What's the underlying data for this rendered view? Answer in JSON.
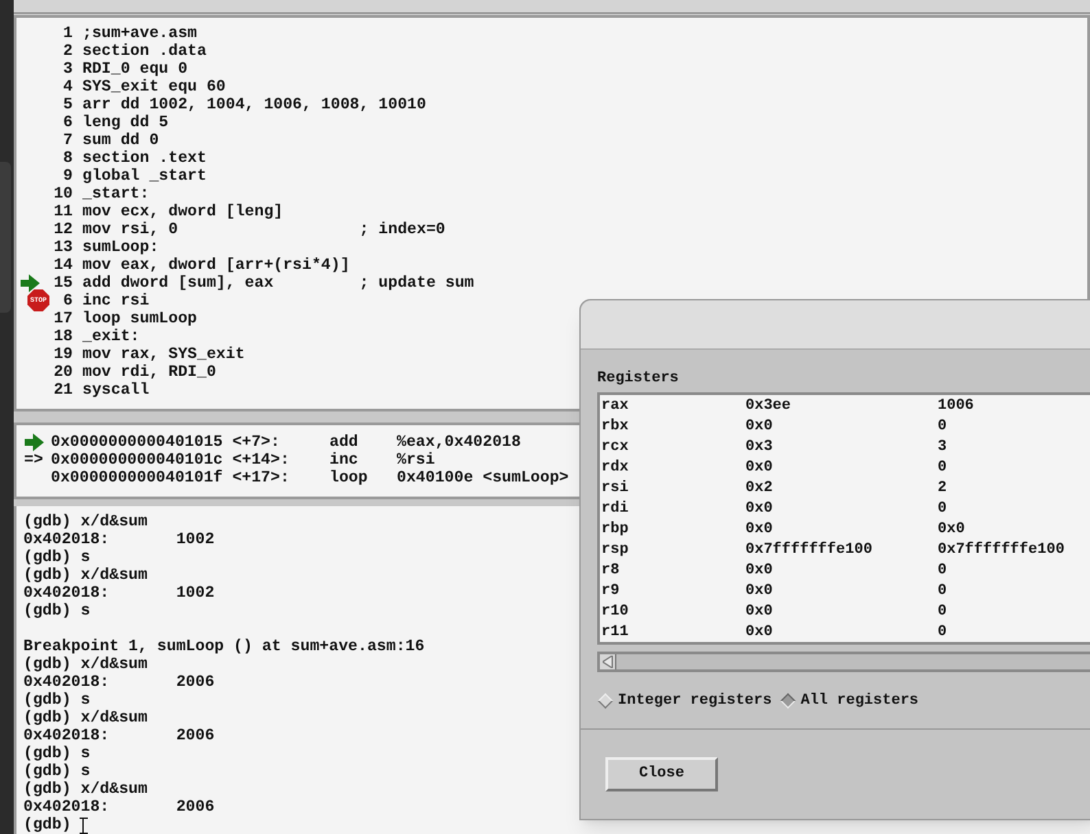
{
  "source": {
    "lines": [
      {
        "number": "1",
        "code": ";sum+ave.asm"
      },
      {
        "number": "2",
        "code": "section .data"
      },
      {
        "number": "3",
        "code": "RDI_0 equ 0"
      },
      {
        "number": "4",
        "code": "SYS_exit equ 60"
      },
      {
        "number": "5",
        "code": "arr dd 1002, 1004, 1006, 1008, 10010"
      },
      {
        "number": "6",
        "code": "leng dd 5"
      },
      {
        "number": "7",
        "code": "sum dd 0"
      },
      {
        "number": "8",
        "code": "section .text"
      },
      {
        "number": "9",
        "code": "global _start"
      },
      {
        "number": "10",
        "code": "_start:"
      },
      {
        "number": "11",
        "code": "mov ecx, dword [leng]"
      },
      {
        "number": "12",
        "code": "mov rsi, 0                   ; index=0"
      },
      {
        "number": "13",
        "code": "sumLoop:"
      },
      {
        "number": "14",
        "code": "mov eax, dword [arr+(rsi*4)]"
      },
      {
        "number": "15",
        "code": "add dword [sum], eax         ; update sum",
        "kind": "execution_line"
      },
      {
        "number": "6",
        "code": "inc rsi",
        "kind": "breakpoint_line",
        "stop_label": "STOP"
      },
      {
        "number": "17",
        "code": "loop sumLoop"
      },
      {
        "number": "18",
        "code": "_exit:"
      },
      {
        "number": "19",
        "code": "mov rax, SYS_exit"
      },
      {
        "number": "20",
        "code": "mov rdi, RDI_0"
      },
      {
        "number": "21",
        "code": "syscall"
      }
    ]
  },
  "disassembly": {
    "lines": [
      {
        "kind": "execution_line",
        "address": "0x0000000000401015 <+7>:",
        "mnemonic": "add",
        "operands": "%eax,0x402018"
      },
      {
        "kind": "current_line",
        "marker_text": "=>",
        "address": "0x000000000040101c <+14>:",
        "mnemonic": "inc",
        "operands": "%rsi"
      },
      {
        "address": "0x000000000040101f <+17>:",
        "mnemonic": "loop",
        "operands": "0x40100e <sumLoop>"
      }
    ]
  },
  "console": {
    "lines": [
      {
        "text": "(gdb) x/d&sum"
      },
      {
        "text": "0x402018:       1002"
      },
      {
        "text": "(gdb) s"
      },
      {
        "text": "(gdb) x/d&sum"
      },
      {
        "text": "0x402018:       1002"
      },
      {
        "text": "(gdb) s"
      },
      {
        "kind": "blank"
      },
      {
        "text": "Breakpoint 1, sumLoop () at sum+ave.asm:16"
      },
      {
        "text": "(gdb) x/d&sum"
      },
      {
        "text": "0x402018:       2006"
      },
      {
        "text": "(gdb) s"
      },
      {
        "text": "(gdb) x/d&sum"
      },
      {
        "text": "0x402018:       2006"
      },
      {
        "text": "(gdb) s"
      },
      {
        "text": "(gdb) s"
      },
      {
        "text": "(gdb) x/d&sum"
      },
      {
        "text": "0x402018:       2006"
      },
      {
        "text": "(gdb) ",
        "kind": "prompt"
      }
    ]
  },
  "registers_dialog": {
    "title": "Registers",
    "rows": [
      {
        "name": "rax",
        "raw": "0x3ee",
        "natural": "1006"
      },
      {
        "name": "rbx",
        "raw": "0x0",
        "natural": "0"
      },
      {
        "name": "rcx",
        "raw": "0x3",
        "natural": "3"
      },
      {
        "name": "rdx",
        "raw": "0x0",
        "natural": "0"
      },
      {
        "name": "rsi",
        "raw": "0x2",
        "natural": "2"
      },
      {
        "name": "rdi",
        "raw": "0x0",
        "natural": "0"
      },
      {
        "name": "rbp",
        "raw": "0x0",
        "natural": "0x0"
      },
      {
        "name": "rsp",
        "raw": "0x7fffffffe100",
        "natural": "0x7fffffffe100"
      },
      {
        "name": "r8",
        "raw": "0x0",
        "natural": "0"
      },
      {
        "name": "r9",
        "raw": "0x0",
        "natural": "0"
      },
      {
        "name": "r10",
        "raw": "0x0",
        "natural": "0"
      },
      {
        "name": "r11",
        "raw": "0x0",
        "natural": "0"
      }
    ],
    "options": [
      {
        "label": "Integer registers",
        "selected": false
      },
      {
        "label": "All registers",
        "selected": true
      }
    ],
    "close_button": "Close"
  }
}
